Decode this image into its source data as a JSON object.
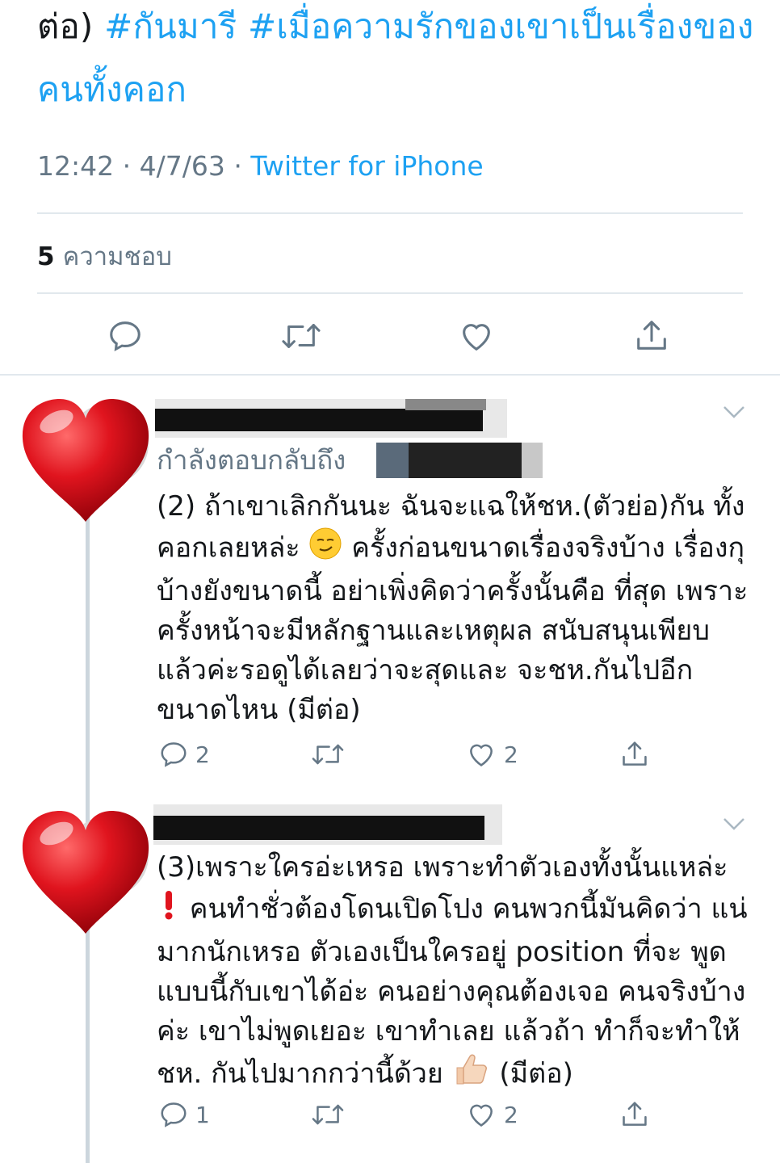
{
  "tweet": {
    "text_line1_prefix": "ต่อ)",
    "hashtag1": "#กันมารี",
    "hashtag2": "#เมื่อความรักของเขาเป็นเรื่องของคนทั้งคอก",
    "time": "12:42",
    "date": "4/7/63",
    "sep": "·",
    "source": "Twitter for iPhone",
    "likes_count": "5",
    "likes_label": "ความชอบ"
  },
  "replies": [
    {
      "replying_to": "กำลังตอบกลับถึง",
      "text": "(2) ถ้าเขาเลิกกันนะ ฉันจะแฉให้ชห.(ตัวย่อ)กัน ทั้งคอกเลยหล่ะ",
      "text_after_emoji": " ครั้งก่อนขนาดเรื่องจริงบ้าง เรื่องกุบ้างยังขนาดนี้ อย่าเพิ่งคิดว่าครั้งนั้นคือ ที่สุด เพราะครั้งหน้าจะมีหลักฐานและเหตุผล สนับสนุนเพียบแล้วค่ะรอดูได้เลยว่าจะสุดและ จะชห.กันไปอีกขนาดไหน (มีต่อ)",
      "reply_count": "2",
      "like_count": "2"
    },
    {
      "text_line1": "(3)เพราะใครอ่ะเหรอ เพราะทำตัวเองทั้งนั้นแหล่ะ",
      "text_rest": " คนทำชั่วต้องโดนเปิดโปง คนพวกนี้มันคิดว่า แน่มากนักเหรอ ตัวเองเป็นใครอยู่ position ที่จะ พูดแบบนี้กับเขาได้อ่ะ คนอย่างคุณต้องเจอ คนจริงบ้างค่ะ เขาไม่พูดเยอะ เขาทำเลย แล้วถ้า ทำก็จะทำให้ชห. กันไปมากกว่านี้ด้วย",
      "text_tail": " (มีต่อ)",
      "reply_count": "1",
      "like_count": "2"
    }
  ],
  "icons": {
    "reply": "reply-icon",
    "retweet": "retweet-icon",
    "like": "heart-icon",
    "share": "share-icon",
    "avatar": "red-heart-avatar",
    "emoji1": "smirk-emoji",
    "emoji2": "exclamation-emoji",
    "emoji3": "thumbs-up-emoji"
  },
  "colors": {
    "accent": "#1da1f2",
    "muted": "#657786",
    "heart": "#e0141e"
  }
}
